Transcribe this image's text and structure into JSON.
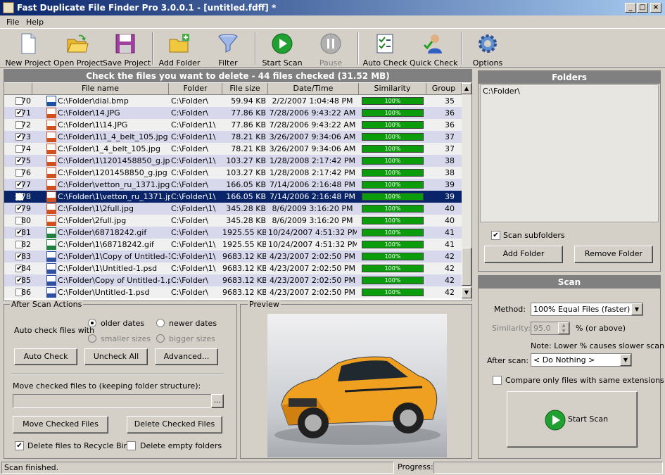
{
  "window": {
    "title": "Fast Duplicate File Finder Pro 3.0.0.1 - [untitled.fdff] *"
  },
  "menu": [
    "File",
    "Help"
  ],
  "toolbar": {
    "new_project": "New Project",
    "open_project": "Open Project",
    "save_project": "Save Project",
    "add_folder": "Add Folder",
    "filter": "Filter",
    "start_scan": "Start Scan",
    "pause": "Pause",
    "auto_check": "Auto Check",
    "quick_check": "Quick Check",
    "options": "Options"
  },
  "list": {
    "header": "Check the files you want to delete - 44 files checked (31.52 MB)",
    "columns": [
      "File name",
      "Folder",
      "File size",
      "Date/Time",
      "Similarity",
      "Group"
    ],
    "rows": [
      {
        "num": "70",
        "checked": false,
        "type": "bmp",
        "name": "C:\\Folder\\dial.bmp",
        "folder": "C:\\Folder\\",
        "size": "59.94 KB",
        "date": "2/2/2007 1:04:48 PM",
        "sim": "100%",
        "group": "35"
      },
      {
        "num": "71",
        "checked": true,
        "type": "jpg",
        "name": "C:\\Folder\\14.JPG",
        "folder": "C:\\Folder\\",
        "size": "77.86 KB",
        "date": "7/28/2006 9:43:22 AM",
        "sim": "100%",
        "group": "36"
      },
      {
        "num": "72",
        "checked": false,
        "type": "jpg",
        "name": "C:\\Folder\\1\\14.JPG",
        "folder": "C:\\Folder\\1\\",
        "size": "77.86 KB",
        "date": "7/28/2006 9:43:22 AM",
        "sim": "100%",
        "group": "36"
      },
      {
        "num": "73",
        "checked": true,
        "type": "jpg",
        "name": "C:\\Folder\\1\\1_4_belt_105.jpg",
        "folder": "C:\\Folder\\1\\",
        "size": "78.21 KB",
        "date": "3/26/2007 9:34:06 AM",
        "sim": "100%",
        "group": "37"
      },
      {
        "num": "74",
        "checked": false,
        "type": "jpg",
        "name": "C:\\Folder\\1_4_belt_105.jpg",
        "folder": "C:\\Folder\\",
        "size": "78.21 KB",
        "date": "3/26/2007 9:34:06 AM",
        "sim": "100%",
        "group": "37"
      },
      {
        "num": "75",
        "checked": true,
        "type": "jpg",
        "name": "C:\\Folder\\1\\1201458850_g.jpg",
        "folder": "C:\\Folder\\1\\",
        "size": "103.27 KB",
        "date": "1/28/2008 2:17:42 PM",
        "sim": "100%",
        "group": "38"
      },
      {
        "num": "76",
        "checked": false,
        "type": "jpg",
        "name": "C:\\Folder\\1201458850_g.jpg",
        "folder": "C:\\Folder\\",
        "size": "103.27 KB",
        "date": "1/28/2008 2:17:42 PM",
        "sim": "100%",
        "group": "38"
      },
      {
        "num": "77",
        "checked": true,
        "type": "jpg",
        "name": "C:\\Folder\\vetton_ru_1371.jpg",
        "folder": "C:\\Folder\\",
        "size": "166.05 KB",
        "date": "7/14/2006 2:16:48 PM",
        "sim": "100%",
        "group": "39"
      },
      {
        "num": "78",
        "checked": false,
        "type": "jpg",
        "name": "C:\\Folder\\1\\vetton_ru_1371.jpg",
        "folder": "C:\\Folder\\1\\",
        "size": "166.05 KB",
        "date": "7/14/2006 2:16:48 PM",
        "sim": "100%",
        "group": "39",
        "selected": true
      },
      {
        "num": "79",
        "checked": true,
        "type": "jpg",
        "name": "C:\\Folder\\1\\2full.jpg",
        "folder": "C:\\Folder\\1\\",
        "size": "345.28 KB",
        "date": "8/6/2009 3:16:20 PM",
        "sim": "100%",
        "group": "40"
      },
      {
        "num": "80",
        "checked": false,
        "type": "jpg",
        "name": "C:\\Folder\\2full.jpg",
        "folder": "C:\\Folder\\",
        "size": "345.28 KB",
        "date": "8/6/2009 3:16:20 PM",
        "sim": "100%",
        "group": "40"
      },
      {
        "num": "81",
        "checked": true,
        "type": "gif",
        "name": "C:\\Folder\\68718242.gif",
        "folder": "C:\\Folder\\",
        "size": "1925.55 KB",
        "date": "10/24/2007 4:51:32 PM",
        "sim": "100%",
        "group": "41"
      },
      {
        "num": "82",
        "checked": false,
        "type": "gif",
        "name": "C:\\Folder\\1\\68718242.gif",
        "folder": "C:\\Folder\\1\\",
        "size": "1925.55 KB",
        "date": "10/24/2007 4:51:32 PM",
        "sim": "100%",
        "group": "41"
      },
      {
        "num": "83",
        "checked": true,
        "type": "psd",
        "name": "C:\\Folder\\1\\Copy of Untitled-1.psd",
        "folder": "C:\\Folder\\1\\",
        "size": "9683.12 KB",
        "date": "4/23/2007 2:02:50 PM",
        "sim": "100%",
        "group": "42"
      },
      {
        "num": "84",
        "checked": true,
        "type": "psd",
        "name": "C:\\Folder\\1\\Untitled-1.psd",
        "folder": "C:\\Folder\\1\\",
        "size": "9683.12 KB",
        "date": "4/23/2007 2:02:50 PM",
        "sim": "100%",
        "group": "42"
      },
      {
        "num": "85",
        "checked": true,
        "type": "psd",
        "name": "C:\\Folder\\Copy of Untitled-1.psd",
        "folder": "C:\\Folder\\",
        "size": "9683.12 KB",
        "date": "4/23/2007 2:02:50 PM",
        "sim": "100%",
        "group": "42"
      },
      {
        "num": "86",
        "checked": false,
        "type": "psd",
        "name": "C:\\Folder\\Untitled-1.psd",
        "folder": "C:\\Folder\\",
        "size": "9683.12 KB",
        "date": "4/23/2007 2:02:50 PM",
        "sim": "100%",
        "group": "42"
      }
    ]
  },
  "folders": {
    "title": "Folders",
    "items": [
      "C:\\Folder\\"
    ],
    "scan_subfolders": "Scan subfolders",
    "add_folder": "Add Folder",
    "remove_folder": "Remove Folder"
  },
  "scan": {
    "title": "Scan",
    "method_label": "Method:",
    "method_value": "100% Equal Files (faster)",
    "similarity_label": "Similarity:",
    "similarity_value": "95.0",
    "similarity_suffix": "% (or above)",
    "note": "Note: Lower % causes slower scan",
    "after_scan_label": "After scan:",
    "after_scan_value": "< Do Nothing >",
    "compare_ext": "Compare only files with same extensions",
    "start_scan": "Start Scan"
  },
  "after_scan_actions": {
    "title": "After Scan Actions",
    "auto_check_label": "Auto check files with",
    "older_dates": "older dates",
    "newer_dates": "newer dates",
    "smaller_sizes": "smaller sizes",
    "bigger_sizes": "bigger sizes",
    "auto_check_btn": "Auto Check",
    "uncheck_all_btn": "Uncheck All",
    "advanced_btn": "Advanced...",
    "move_label": "Move checked files to (keeping folder structure):",
    "move_path": "",
    "browse": "...",
    "move_btn": "Move Checked Files",
    "delete_btn": "Delete Checked Files",
    "recycle": "Delete files to Recycle Bin",
    "delete_empty": "Delete empty folders"
  },
  "preview": {
    "title": "Preview"
  },
  "status": {
    "text": "Scan finished.",
    "progress_label": "Progress:"
  },
  "colors": {
    "row_alt": "#d8d8ec",
    "row_plain": "#f0f0f0",
    "selected": "#0a246a",
    "sim_green": "#0a9c0a"
  }
}
